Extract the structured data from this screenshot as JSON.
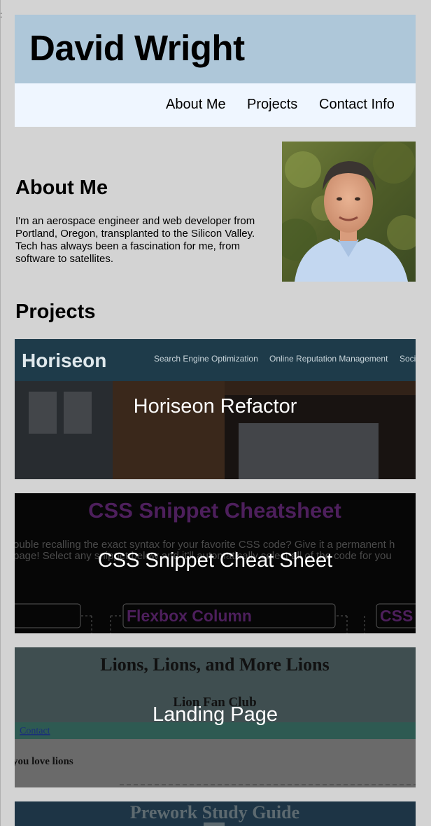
{
  "header": {
    "name": "David Wright"
  },
  "nav": {
    "items": [
      "About Me",
      "Projects",
      "Contact Info"
    ]
  },
  "about": {
    "title": "About Me",
    "text": "I'm an aerospace engineer and web developer from Portland, Oregon, transplanted to the Silicon Valley. Tech has always been a fascination for me, from software to satellites."
  },
  "projects": {
    "title": "Projects",
    "items": [
      {
        "label": "Horiseon Refactor",
        "thumb": {
          "brand": "Horiseon",
          "nav": [
            "Search Engine Optimization",
            "Online Reputation Management",
            "Soci"
          ]
        }
      },
      {
        "label": "CSS Snippet Cheat Sheet",
        "thumb": {
          "title": "CSS Snippet Cheatsheet",
          "line1": "ouble recalling the exact syntax for your favorite CSS code? Give it a permanent h",
          "line2": "page! Select any snippet below and it'll automatically select all of the code for you",
          "box_left": "",
          "box_mid": "Flexbox Column",
          "box_right": "CSS"
        }
      },
      {
        "label": "Landing Page",
        "thumb": {
          "title": "Lions, Lions, and More Lions",
          "subtitle": "Lion Fan Club",
          "link": "Contact",
          "text": "you love lions"
        }
      },
      {
        "label": "",
        "thumb": {
          "title": "Prework Study Guide"
        }
      }
    ]
  },
  "colors": {
    "page_bg": "#d3d3d3",
    "header_bg": "#aec7d9",
    "nav_bg": "#eff6ff"
  }
}
